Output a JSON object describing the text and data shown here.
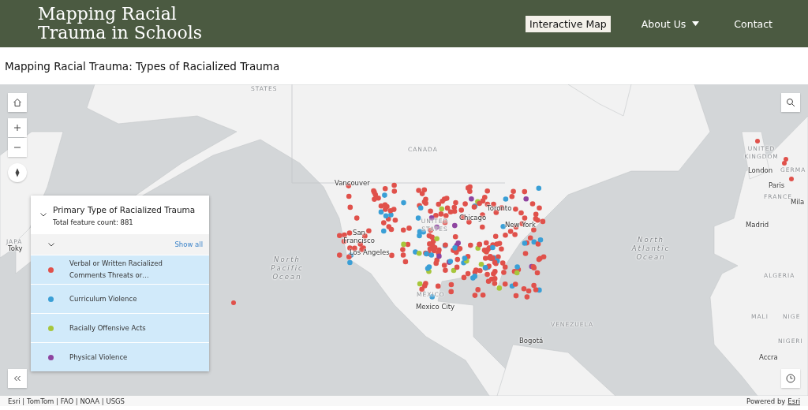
{
  "header": {
    "title": "Mapping Racial Trauma in Schools",
    "nav": [
      {
        "label": "Interactive Map",
        "selected": true,
        "kind": "link"
      },
      {
        "label": "About Us",
        "selected": false,
        "kind": "dropdown"
      },
      {
        "label": "Contact",
        "selected": false,
        "kind": "link"
      }
    ]
  },
  "page_title": "Mapping Racial Trauma: Types of Racialized Trauma",
  "map": {
    "labels": [
      {
        "text": "STATES",
        "kind": "country"
      },
      {
        "text": "CANADA",
        "kind": "country"
      },
      {
        "text": "UNITED STATES",
        "kind": "country"
      },
      {
        "text": "MÉXICO",
        "kind": "country"
      },
      {
        "text": "Vancouver",
        "kind": "city"
      },
      {
        "text": "San Francisco",
        "kind": "city"
      },
      {
        "text": "Los Angeles",
        "kind": "city"
      },
      {
        "text": "Chicago",
        "kind": "city"
      },
      {
        "text": "Toronto",
        "kind": "city"
      },
      {
        "text": "New York",
        "kind": "city"
      },
      {
        "text": "Mexico City",
        "kind": "city"
      },
      {
        "text": "North Pacific Ocean",
        "kind": "ocean"
      },
      {
        "text": "North Atlantic Ocean",
        "kind": "ocean"
      },
      {
        "text": "UNITED KINGDOM",
        "kind": "country"
      },
      {
        "text": "London",
        "kind": "city"
      },
      {
        "text": "GERMA",
        "kind": "country"
      },
      {
        "text": "Paris",
        "kind": "city"
      },
      {
        "text": "FRANCE",
        "kind": "country"
      },
      {
        "text": "Mila",
        "kind": "city"
      },
      {
        "text": "Madrid",
        "kind": "city"
      },
      {
        "text": "ALGERIA",
        "kind": "country"
      },
      {
        "text": "MALI",
        "kind": "country"
      },
      {
        "text": "NIGE",
        "kind": "country"
      },
      {
        "text": "NIGERI",
        "kind": "country"
      },
      {
        "text": "Accra",
        "kind": "city"
      },
      {
        "text": "VENEZUELA",
        "kind": "country"
      },
      {
        "text": "Bogotá",
        "kind": "city"
      },
      {
        "text": "JAPA",
        "kind": "country"
      },
      {
        "text": "Toky",
        "kind": "city"
      }
    ]
  },
  "legend": {
    "title": "Primary Type of Racialized Trauma",
    "count": "Total feature count: 881",
    "show_all": "Show all",
    "items": [
      {
        "label": "Verbal or Written Racialized Comments Threats or…",
        "color": "#e0514b"
      },
      {
        "label": "Curriculum Violence",
        "color": "#3a9fd6"
      },
      {
        "label": "Racially Offensive Acts",
        "color": "#a7c63c"
      },
      {
        "label": "Physical Violence",
        "color": "#8e44a0"
      }
    ]
  },
  "attribution": {
    "sources": "Esri | TomTom | FAO | NOAA | USGS",
    "powered_by": "Powered by",
    "link": "Esri"
  }
}
